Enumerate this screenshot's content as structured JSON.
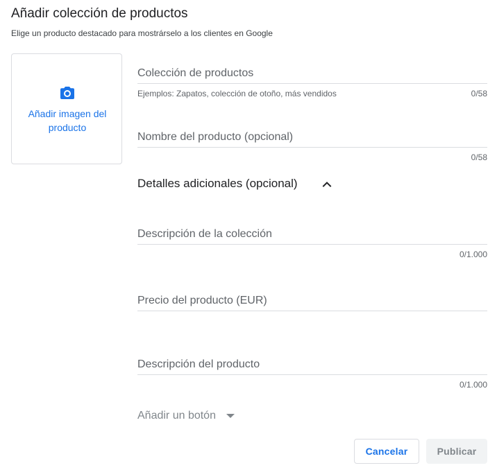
{
  "dialog": {
    "title": "Añadir colección de productos",
    "subtitle": "Elige un producto destacado para mostrárselo a los clientes en Google"
  },
  "image_upload": {
    "icon": "camera-icon",
    "label_line1": "Añadir imagen del",
    "label_line2": "producto",
    "accent_color": "#1a73e8"
  },
  "fields": {
    "collection": {
      "placeholder": "Colección de productos",
      "helper": "Ejemplos: Zapatos, colección de otoño, más vendidos",
      "counter": "0/58"
    },
    "product_name": {
      "placeholder": "Nombre del producto (opcional)",
      "counter": "0/58"
    },
    "collection_description": {
      "placeholder": "Descripción de la colección",
      "counter": "0/1.000"
    },
    "product_price": {
      "placeholder": "Precio del producto (EUR)"
    },
    "product_description": {
      "placeholder": "Descripción del producto",
      "counter": "0/1.000"
    }
  },
  "additional_details": {
    "label": "Detalles adicionales (opcional)",
    "icon": "chevron-up-icon",
    "expanded": true
  },
  "add_button": {
    "label": "Añadir un botón",
    "icon": "caret-down-icon"
  },
  "actions": {
    "cancel_label": "Cancelar",
    "publish_label": "Publicar",
    "publish_enabled": false
  }
}
